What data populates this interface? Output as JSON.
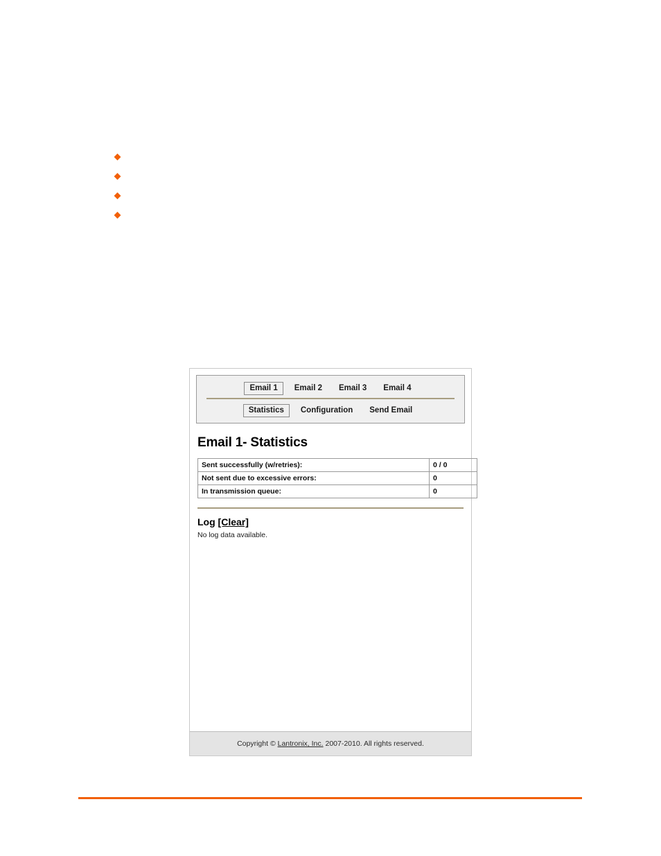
{
  "document": {
    "bullets": [
      {
        "text": ""
      },
      {
        "text": ""
      },
      {
        "text": ""
      },
      {
        "text": ""
      }
    ],
    "bullet_color": "#f26007",
    "rule_color": "#f26007"
  },
  "screenshot": {
    "nav": {
      "primary_tabs": [
        {
          "label": "Email 1",
          "selected": true
        },
        {
          "label": "Email 2",
          "selected": false
        },
        {
          "label": "Email 3",
          "selected": false
        },
        {
          "label": "Email 4",
          "selected": false
        }
      ],
      "secondary_tabs": [
        {
          "label": "Statistics",
          "selected": true
        },
        {
          "label": "Configuration",
          "selected": false
        },
        {
          "label": "Send Email",
          "selected": false
        }
      ],
      "divider_color": "#a79d80"
    },
    "page_title": "Email 1- Statistics",
    "stats_table": {
      "rows": [
        {
          "label": "Sent successfully (w/retries):",
          "value": "0 / 0"
        },
        {
          "label": "Not sent due to excessive errors:",
          "value": "0"
        },
        {
          "label": "In transmission queue:",
          "value": "0"
        }
      ]
    },
    "log": {
      "heading": "Log",
      "clear_label": "[Clear]",
      "empty_message": "No log data available."
    },
    "footer": {
      "prefix": "Copyright © ",
      "company": "Lantronix, Inc.",
      "suffix": " 2007-2010. All rights reserved."
    }
  }
}
